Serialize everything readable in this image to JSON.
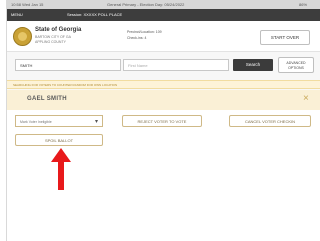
{
  "status_bar": {
    "left": "10:58 Wed Jan 15",
    "center": "General Primary - Election Day: 05/24/2022",
    "right": "86%"
  },
  "app_bar": {
    "menu_label": "MENU",
    "session": "Session: XXXXX POLL PLACE"
  },
  "header": {
    "state_name": "State of Georgia",
    "county_line1": "BARTOW CITY OF GA",
    "county_line2": "APPLING COUNTY",
    "precinct_label": "Precinct/Location: 109",
    "checkins_label": "Check-ins: 4",
    "start_over_label": "START OVER"
  },
  "search": {
    "last_name_value": "SMITH",
    "first_name_placeholder": "First Name",
    "search_label": "Search",
    "advanced_label": "ADVANCED OPTIONS"
  },
  "notice_text": "SEARCHING FOR VOTERS TO COUNTER RANDOM FOR OWN LOCATION",
  "voter": {
    "name": "GAEL SMITH",
    "close_glyph": "×"
  },
  "actions": {
    "status_select_value": "Mark Voter Ineligible",
    "chevron_glyph": "▾",
    "reject_label": "REJECT VOTER TO VOTE",
    "cancel_label": "CANCEL VOTER CHECKIN",
    "spoil_label": "SPOIL BALLOT"
  },
  "colors": {
    "highlight_arrow": "#e8191b",
    "voter_bar_bg": "#faf0d6",
    "app_bar_bg": "#3d3d3d",
    "search_button_bg": "#3b3b3b"
  }
}
